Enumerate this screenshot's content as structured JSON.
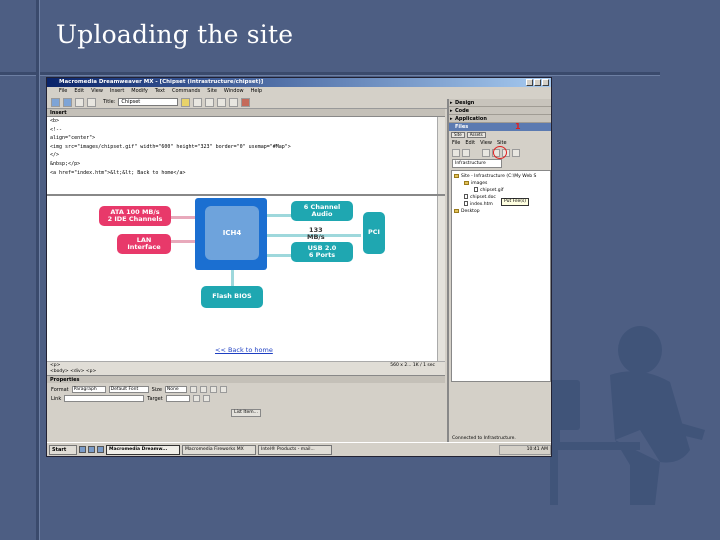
{
  "slide": {
    "title": "Uploading the site"
  },
  "window": {
    "title": "Macromedia Dreamweaver MX - [Chipset (intrastructure/chipset)]",
    "menu": [
      "File",
      "Edit",
      "View",
      "Insert",
      "Modify",
      "Text",
      "Commands",
      "Site",
      "Window",
      "Help"
    ],
    "toolbar_title_label": "Title:",
    "toolbar_title_value": "Chipset"
  },
  "code_panel": {
    "header": "Insert",
    "lines": [
      "<b>",
      "",
      "<!--",
      "align=\"center\">",
      "<img src=\"images/chipset.gif\" width=\"600\" height=\"323\" border=\"0\" usemap=\"#Map\">",
      "</>",
      "&nbsp;</p>",
      "<a href=\"index.htm\">&lt;&lt; Back to home</a>"
    ]
  },
  "diagram": {
    "ata": "ATA 100 MB/s\n2 IDE Channels",
    "lan": "LAN\nInterface",
    "ich": "ICH4",
    "audio": "6 Channel\nAudio",
    "bus": "133\nMB/s",
    "usb": "USB 2.0\n6 Ports",
    "pci": "PCI",
    "bios": "Flash BIOS",
    "back_link": "<< Back to home"
  },
  "status": {
    "tag": "<p>",
    "tag_path": "<body> <div> <p>",
    "size": "560 x 2... 1K / 1 sec"
  },
  "properties": {
    "header": "Properties",
    "format_label": "Format",
    "format_value": "Paragraph",
    "style_value": "Default Font",
    "size_label": "Size",
    "size_value": "None",
    "link_label": "Link",
    "target_label": "Target",
    "list_item_button": "List Item..."
  },
  "right_panel": {
    "groups": [
      "Design",
      "Code",
      "Application"
    ],
    "files_header": "Files",
    "file_tabs": [
      "Site",
      "Assets"
    ],
    "files_menu": [
      "File",
      "Edit",
      "View",
      "Site"
    ],
    "site_select": "Infrastructure",
    "tooltip": "Put File(s)",
    "annotation": "1",
    "tree": [
      "Site - Infrastructure (C:\\My Web S",
      "images",
      "chipset.gif",
      "chipset.doc",
      "index.htm",
      "Desktop"
    ],
    "connected": "Connected to Infrastructure."
  },
  "taskbar": {
    "start": "Start",
    "tasks": [
      "Macromedia Dreamw...",
      "Macromedia Fireworks MX",
      "Intel® Products - mail..."
    ],
    "clock": "10:41 AM"
  }
}
